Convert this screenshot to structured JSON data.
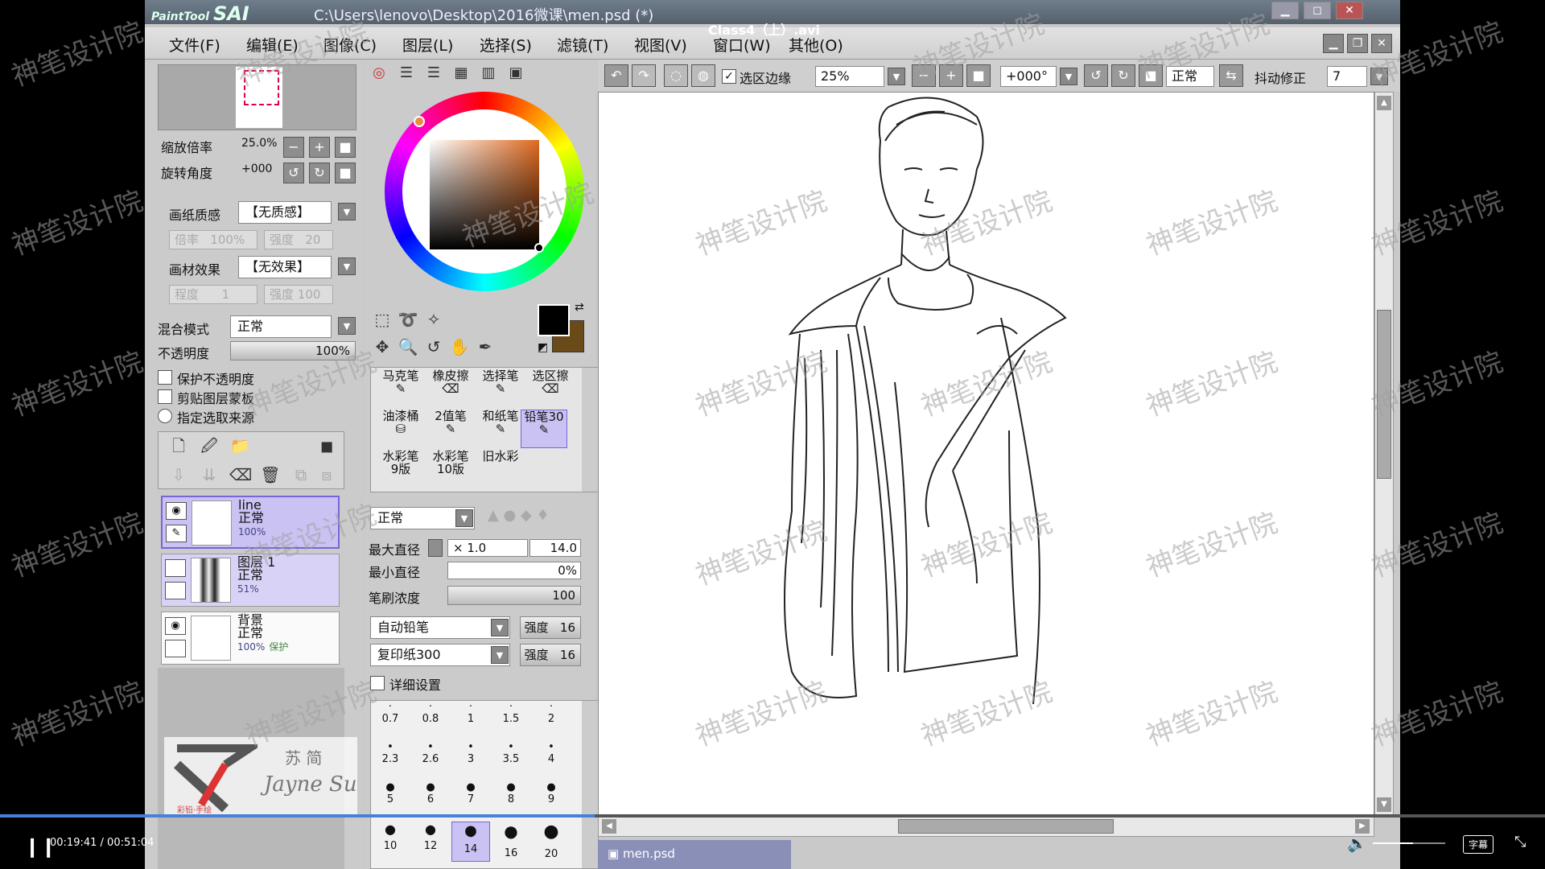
{
  "video": {
    "title": "Class4（上）.avi",
    "current_time": "00:19:41",
    "total_time": "00:51:04",
    "time_sep": " / ",
    "progress": 0.385,
    "volume": 0.55,
    "subtitle_button": "字幕"
  },
  "app": {
    "logo_small": "PaintTool",
    "logo_big": "SAI",
    "file_path": "C:\\Users\\lenovo\\Desktop\\2016微课\\men.psd (*)"
  },
  "menu": [
    "文件(F)",
    "编辑(E)",
    "图像(C)",
    "图层(L)",
    "选择(S)",
    "滤镜(T)",
    "视图(V)",
    "窗口(W)",
    "其他(O)"
  ],
  "navigator": {
    "zoom_label": "缩放倍率",
    "zoom_value": "25.0%",
    "rotate_label": "旋转角度",
    "rotate_value": "+000"
  },
  "paper": {
    "texture_label": "画纸质感",
    "texture_value": "【无质感】",
    "ratio_label": "倍率",
    "ratio_value": "100%",
    "strength_label": "强度",
    "strength_value": "20",
    "effect_label": "画材效果",
    "effect_value": "【无效果】",
    "degree_label": "程度",
    "degree_value": "1",
    "strength2_label": "强度",
    "strength2_value": "100"
  },
  "layer_props": {
    "blend_label": "混合模式",
    "blend_value": "正常",
    "opacity_label": "不透明度",
    "opacity_value": "100%",
    "opt1": "保护不透明度",
    "opt2": "剪贴图层蒙板",
    "opt3": "指定选取来源"
  },
  "layers": [
    {
      "name": "line",
      "mode": "正常",
      "opacity": "100%",
      "extra": ""
    },
    {
      "name": "图层 1",
      "mode": "正常",
      "opacity": "51%",
      "extra": ""
    },
    {
      "name": "背景",
      "mode": "正常",
      "opacity": "100%",
      "extra": "保护"
    }
  ],
  "watermark_logo": {
    "name_cn": "苏 简",
    "name_en": "Jayne Su",
    "tag": "彩铅·手绘"
  },
  "brushes": [
    [
      "马克笔",
      "橡皮擦",
      "选择笔",
      "选区擦"
    ],
    [
      "油漆桶",
      "2值笔",
      "和纸笔",
      "铅笔30"
    ],
    [
      "水彩笔\n9版",
      "水彩笔\n10版",
      "旧水彩",
      ""
    ]
  ],
  "brush_settings": {
    "mode": "正常",
    "max_size_label": "最大直径",
    "max_size_mult": "× 1.0",
    "max_size_value": "14.0",
    "min_size_label": "最小直径",
    "min_size_value": "0%",
    "density_label": "笔刷浓度",
    "density_value": "100",
    "shape": "自动铅笔",
    "shape_strength_label": "强度",
    "shape_strength_value": "16",
    "texture": "复印纸300",
    "texture_strength_label": "强度",
    "texture_strength_value": "16",
    "detail_label": "详细设置"
  },
  "sizes": [
    [
      "0.7",
      "0.8",
      "1",
      "1.5",
      "2"
    ],
    [
      "2.3",
      "2.6",
      "3",
      "3.5",
      "4"
    ],
    [
      "5",
      "6",
      "7",
      "8",
      "9"
    ],
    [
      "10",
      "12",
      "14",
      "16",
      "20"
    ]
  ],
  "toolbar": {
    "selection_edge_label": "选区边缘",
    "zoom": "25%",
    "angle": "+000°",
    "blend": "正常",
    "stabilizer_label": "抖动修正",
    "stabilizer_value": "7"
  },
  "canvas_tab": "men.psd",
  "watermark_text": "神笔设计院",
  "colors": {
    "primary": "#000000",
    "secondary": "#6b4a1a",
    "selection": "#7a64d8"
  }
}
